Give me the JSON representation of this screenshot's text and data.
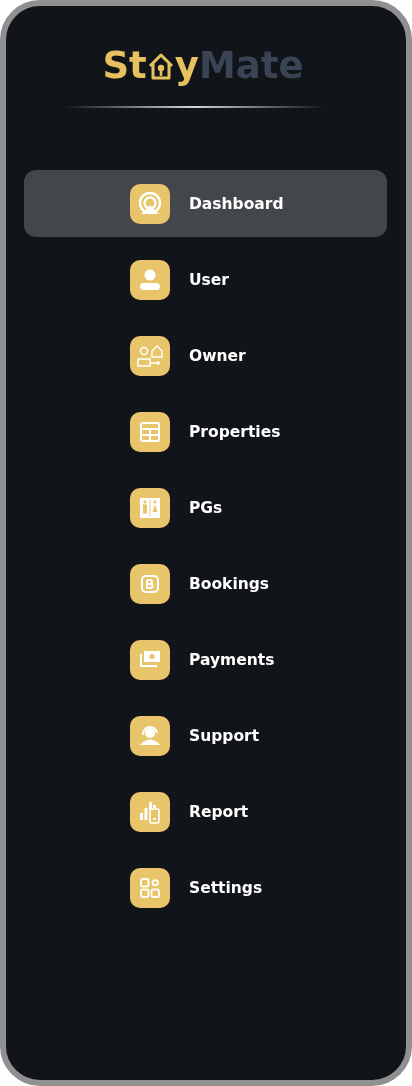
{
  "logo": {
    "lead": "St",
    "middle": "y",
    "tail": "Mate"
  },
  "menu": [
    {
      "label": "Dashboard",
      "selected": true
    },
    {
      "label": "User",
      "selected": false
    },
    {
      "label": "Owner",
      "selected": false
    },
    {
      "label": "Properties",
      "selected": false
    },
    {
      "label": "PGs",
      "selected": false
    },
    {
      "label": "Bookings",
      "selected": false
    },
    {
      "label": "Payments",
      "selected": false
    },
    {
      "label": "Support",
      "selected": false
    },
    {
      "label": "Report",
      "selected": false
    },
    {
      "label": "Settings",
      "selected": false
    }
  ]
}
